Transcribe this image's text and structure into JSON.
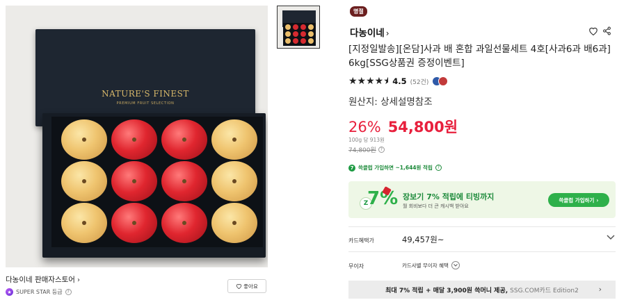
{
  "image": {
    "box_brand": "NATURE'S FINEST",
    "box_subtitle": "PREMIUM FRUIT SELECTION"
  },
  "seller": {
    "name": "다농이네 판매자스토어",
    "grade": "SUPER STAR 등급",
    "like_label": "좋아요"
  },
  "product": {
    "tag": "명절",
    "store": "다농이네",
    "title": "[지정일발송][온담]사과 배 혼합 과일선물세트 4호[사과6과 배6과] 6kg[SSG상품권 증정이벤트]",
    "rating": 4.5,
    "rating_text": "4.5",
    "review_count": "(52건)",
    "origin": "원산지: 상세설명참조"
  },
  "price": {
    "discount": "26%",
    "amount": "54,800원",
    "unit_price": "100g 당 913원",
    "original": "74,800원"
  },
  "club": {
    "line": "쓱클럽 가입하면 ~1,644원 적립",
    "banner_title": "장보기 7% 적립에 티빙까지",
    "banner_sub": "월 회비보다 더 큰 캐시백 받아요",
    "banner_button": "쓱클럽 가입하기",
    "logo_text": "7%"
  },
  "card": {
    "label": "카드혜택가",
    "amount": "49,457원~"
  },
  "muija": {
    "label": "무이자",
    "value": "카드사별 무이자 혜택"
  },
  "promo": {
    "bold": "최대 7% 적립 + 매달 3,900원 쓱머니 제공,",
    "grey": "SSG.COM카드 Edition2"
  },
  "colors": {
    "sale_red": "#e8203d",
    "club_green": "#2eb04a",
    "tag_brown": "#6b1f1f"
  }
}
